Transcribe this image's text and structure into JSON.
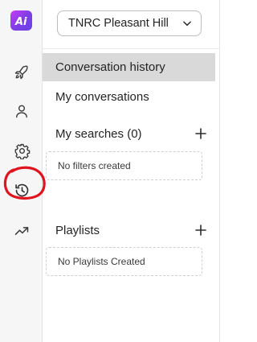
{
  "app": {
    "logo_text": "Ai",
    "brand_color": "#b53cf0",
    "highlight_color": "#e0141e"
  },
  "rail": {
    "items": [
      {
        "icon": "rocket-icon"
      },
      {
        "icon": "person-icon"
      },
      {
        "icon": "gear-icon"
      },
      {
        "icon": "history-icon",
        "highlighted": true
      },
      {
        "icon": "trending-up-icon"
      }
    ]
  },
  "main": {
    "org_select": {
      "value": "TNRC Pleasant Hill"
    },
    "menu": [
      {
        "label": "Conversation history",
        "active": true
      },
      {
        "label": "My conversations",
        "active": false
      }
    ],
    "searches": {
      "title": "My searches (0)",
      "empty_text": "No filters created"
    },
    "playlists": {
      "title": "Playlists",
      "empty_text": "No Playlists Created"
    }
  }
}
